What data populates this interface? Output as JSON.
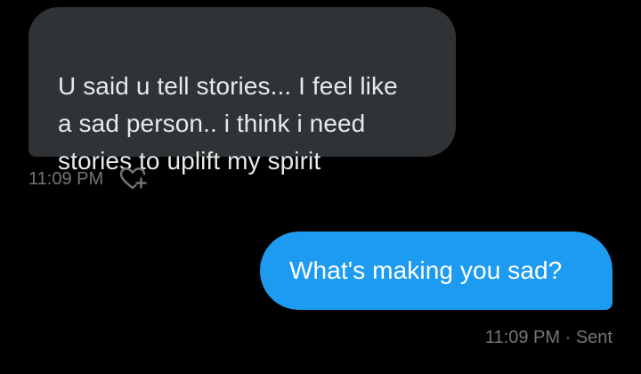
{
  "messages": [
    {
      "direction": "received",
      "text": "U said u tell stories... I feel like\na sad person.. i think i need\nstories to uplift my spirit",
      "time": "11:09 PM",
      "reaction_icon": "heart-plus-icon"
    },
    {
      "direction": "sent",
      "text": "What's making you sad?",
      "time": "11:09 PM",
      "separator": "·",
      "status": "Sent"
    }
  ],
  "colors": {
    "background": "#000000",
    "received_bubble": "#2f3336",
    "received_text": "#e7e9ea",
    "sent_bubble": "#1d9bf0",
    "sent_text": "#ffffff",
    "meta_text": "#71767b"
  }
}
